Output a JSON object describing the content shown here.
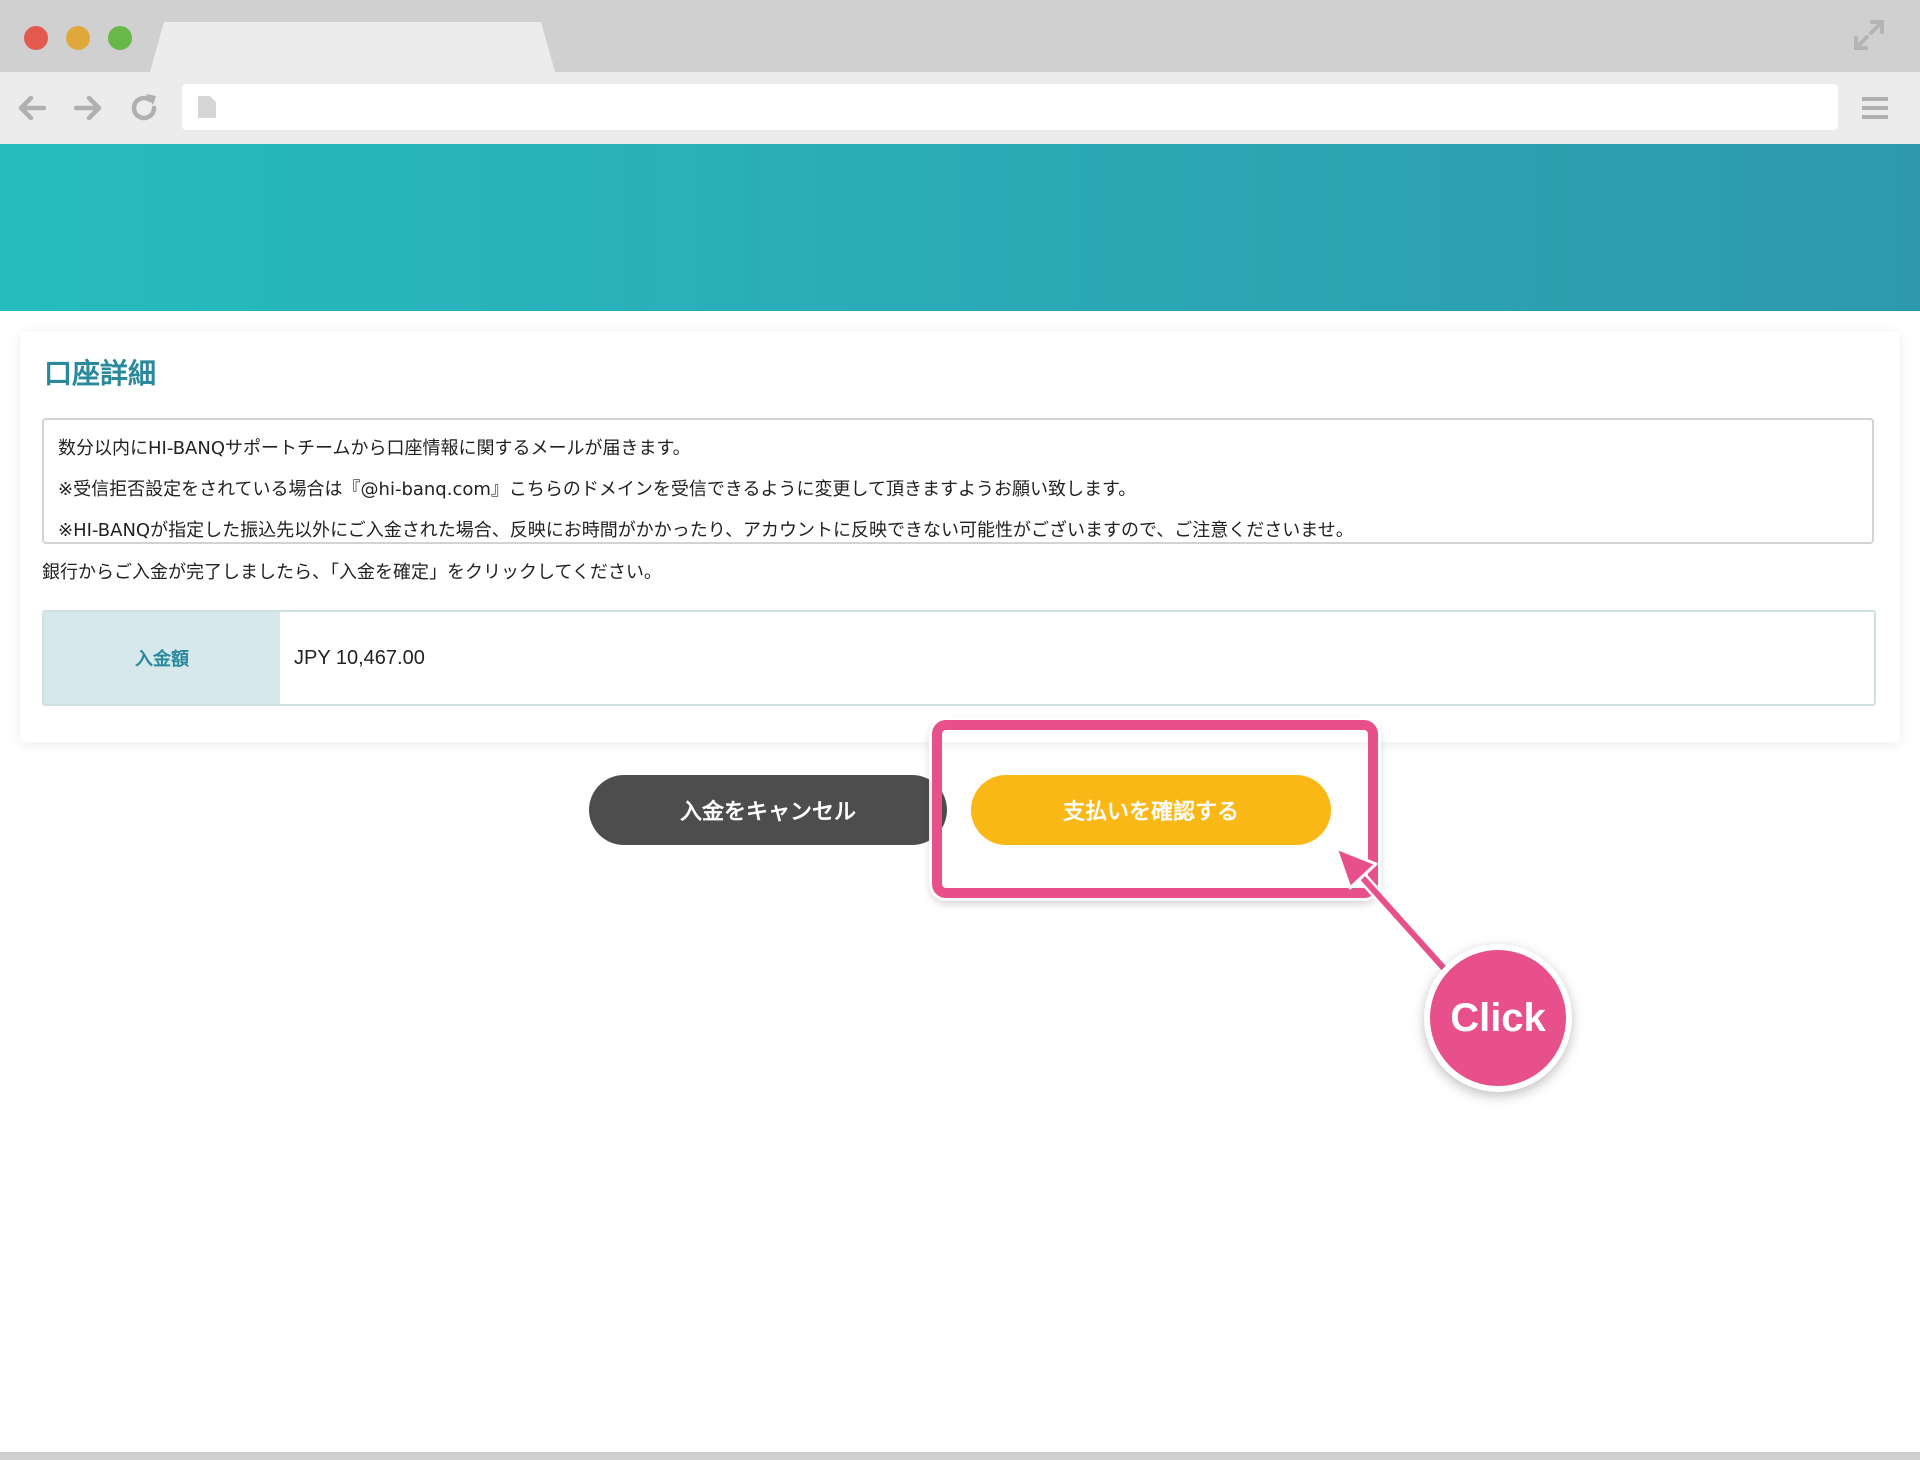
{
  "browser": {
    "url": ""
  },
  "card": {
    "title": "口座詳細",
    "notice_lines": [
      "数分以内にHI-BANQサポートチームから口座情報に関するメールが届きます。",
      "※受信拒否設定をされている場合は『@hi-banq.com』こちらのドメインを受信できるように変更して頂きますようお願い致します。",
      "※HI-BANQが指定した振込先以外にご入金された場合、反映にお時間がかかったり、アカウントに反映できない可能性がございますので、ご注意くださいませ。"
    ],
    "instruction": "銀行からご入金が完了しましたら、「入金を確定」をクリックしてください。",
    "amount_label": "入金額",
    "amount_value": "JPY 10,467.00"
  },
  "buttons": {
    "cancel_label": "入金をキャンセル",
    "confirm_label": "支払いを確認する"
  },
  "annotation": {
    "click_label": "Click",
    "color": "#e8508c"
  },
  "colors": {
    "banner_start": "#25bcbd",
    "banner_end": "#2e99ad",
    "accent": "#2a8a9c",
    "confirm": "#f9b815",
    "cancel": "#4d4d4d"
  }
}
